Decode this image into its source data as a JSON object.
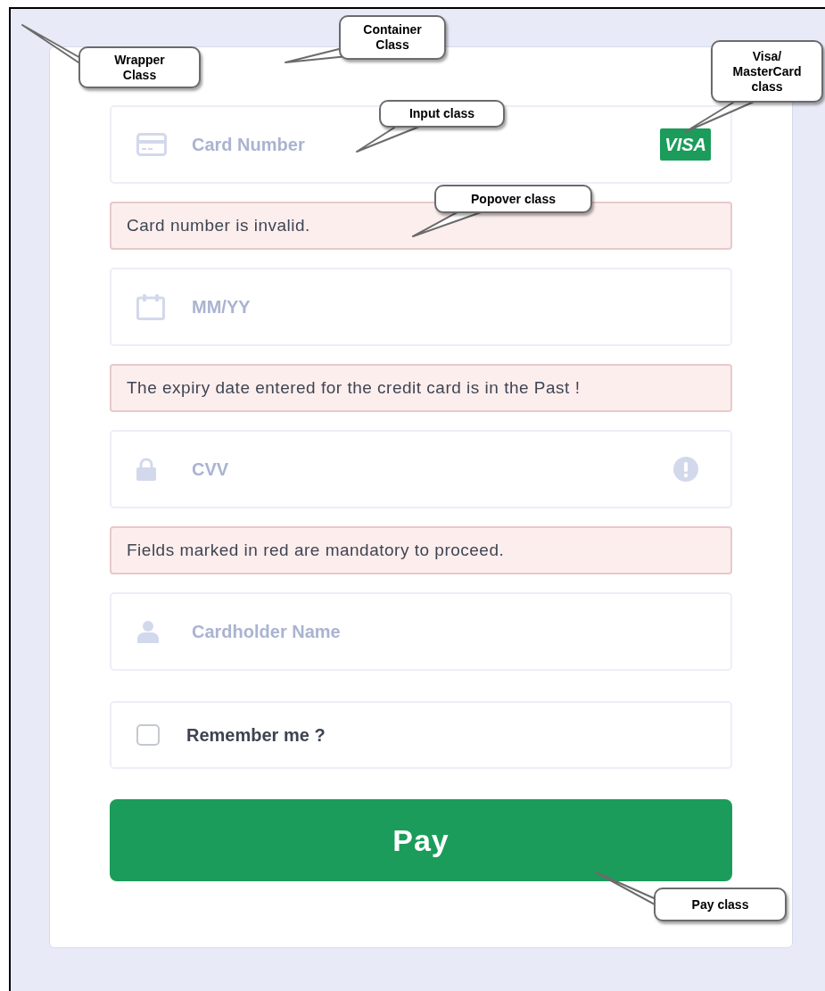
{
  "form": [
    {
      "kind": "card_number",
      "placeholder": "Card Number",
      "badge": "VISA"
    },
    {
      "kind": "error",
      "text": "Card number is invalid."
    },
    {
      "kind": "expiry",
      "placeholder": "MM/YY"
    },
    {
      "kind": "error",
      "text": "The expiry date entered for the credit card is in the Past !"
    },
    {
      "kind": "cvv",
      "placeholder": "CVV",
      "alert": true
    },
    {
      "kind": "error",
      "text": "Fields marked in red are mandatory to proceed."
    },
    {
      "kind": "cardholder",
      "placeholder": "Cardholder Name"
    }
  ],
  "remember": {
    "label": "Remember me ?",
    "checked": false
  },
  "pay_button": {
    "label": "Pay"
  },
  "callouts": [
    {
      "text": "Wrapper Class"
    },
    {
      "text": "Container Class"
    },
    {
      "text": "Visa/ MasterCard class"
    },
    {
      "text": "Input class"
    },
    {
      "text": "Popover class"
    },
    {
      "text": "Pay class"
    }
  ]
}
